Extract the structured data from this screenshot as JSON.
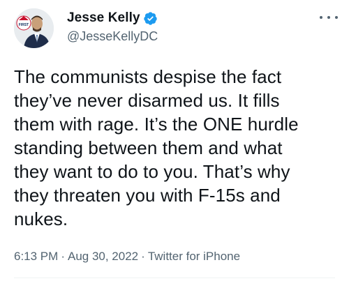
{
  "user": {
    "display_name": "Jesse Kelly",
    "handle": "@JesseKellyDC",
    "verified": true,
    "avatar_badge_text": "FIRST"
  },
  "tweet": {
    "text": "The communists despise the fact\nthey’ve never disarmed us. It fills\nthem with rage. It’s the ONE hurdle\nstanding between them and what\nthey want to do to you. That’s why\nthey threaten you with F-15s and\nnukes.",
    "time": "6:13 PM",
    "date": "Aug 30, 2022",
    "source": "Twitter for iPhone",
    "separator": "·"
  },
  "icons": {
    "verified": "verified-badge-icon",
    "more": "more-options-icon"
  },
  "colors": {
    "verified_blue": "#1d9bf0",
    "text_primary": "#0f1419",
    "text_secondary": "#536471"
  }
}
